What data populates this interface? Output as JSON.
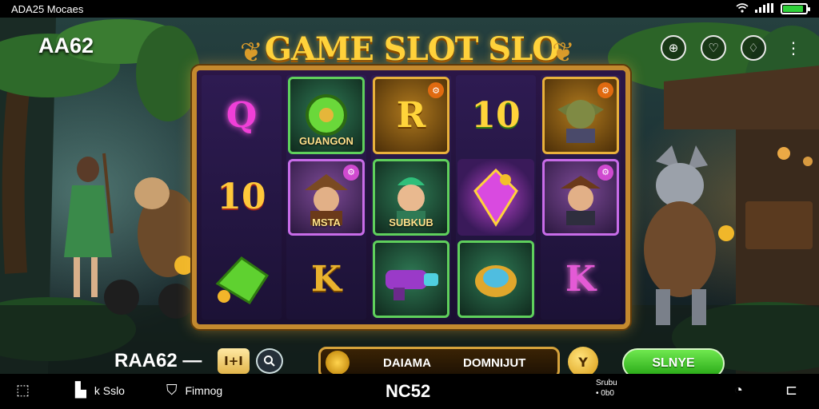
{
  "status_bar": {
    "left_text": "ADA25 Mocaes",
    "battery_level": 0.9,
    "icons": [
      "wifi-icon",
      "signal-icon",
      "battery-icon"
    ]
  },
  "header": {
    "app_name": "AA62",
    "game_title": "GAME SLOT SLO",
    "icons": [
      "globe-icon",
      "heart-icon",
      "diamond-heart-icon",
      "more-icon"
    ]
  },
  "reels": [
    [
      {
        "symbol": "letter-Q",
        "text": "Q",
        "color": "#f03fd8"
      },
      {
        "symbol": "number-10",
        "text": "10",
        "color": "#ffc83a"
      },
      {
        "symbol": "green-gem",
        "text": "",
        "color": "#5fd130"
      }
    ],
    [
      {
        "symbol": "green-disc",
        "text": "",
        "label": "GUANGON",
        "color": "#5fd05c"
      },
      {
        "symbol": "adventurer",
        "text": "",
        "label": "MSTA",
        "color": "#c86ce8"
      },
      {
        "symbol": "letter-K",
        "text": "K",
        "color": "#e9b22e"
      }
    ],
    [
      {
        "symbol": "letter-R",
        "text": "R",
        "color": "#ffd43a"
      },
      {
        "symbol": "elf",
        "text": "",
        "label": "SUBKUB",
        "color": "#5fd05c"
      },
      {
        "symbol": "blaster",
        "text": "",
        "color": "#5fd05c"
      }
    ],
    [
      {
        "symbol": "number-10",
        "text": "10",
        "color": "#ffd43a"
      },
      {
        "symbol": "purple-crystal",
        "text": "",
        "color": "#d94ae0"
      },
      {
        "symbol": "gold-ring",
        "text": "",
        "color": "#4fbde0"
      }
    ],
    [
      {
        "symbol": "goblin",
        "text": "",
        "color": "#e9b13b"
      },
      {
        "symbol": "explorer",
        "text": "",
        "color": "#c86ce8"
      },
      {
        "symbol": "letter-K",
        "text": "K",
        "color": "#e45ad6"
      }
    ]
  ],
  "controls": {
    "bet_label": "RAA62 —",
    "bet_button": "I+I",
    "info_left": "DAIAMA",
    "info_right": "DOMNIJUT",
    "y_button": "Y",
    "spin_label": "SLNYE"
  },
  "bottom_nav": {
    "back_icon": "back-icon",
    "item1_label": "k Sslo",
    "item2_label": "Fimnog",
    "center_label": "NC52",
    "small_line1": "Srubu",
    "small_line2": "• 0b0",
    "right_icons": [
      "clock-icon",
      "expand-icon"
    ]
  },
  "colors": {
    "title_gold": "#ffd23b",
    "frame_gold": "#c4892e",
    "spin_green": "#2fbf1c"
  }
}
